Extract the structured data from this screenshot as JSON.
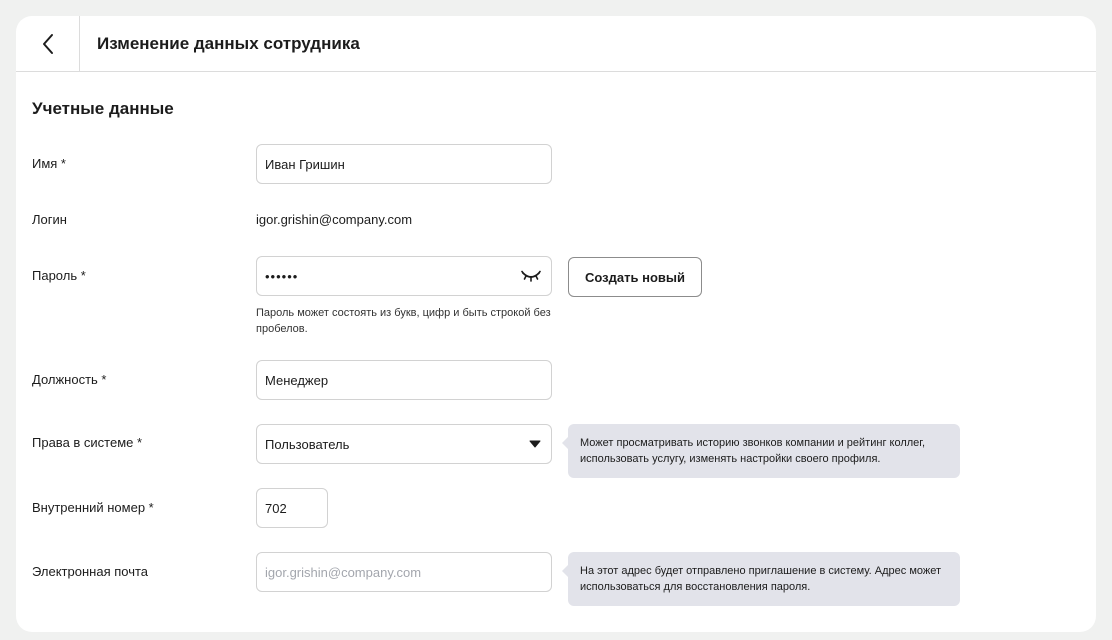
{
  "header": {
    "title": "Изменение данных сотрудника"
  },
  "section": {
    "title": "Учетные данные"
  },
  "form": {
    "name": {
      "label": "Имя *",
      "value": "Иван Гришин"
    },
    "login": {
      "label": "Логин",
      "value": "igor.grishin@company.com"
    },
    "password": {
      "label": "Пароль *",
      "value": "••••••",
      "hint": "Пароль может состоять из букв, цифр и быть строкой без пробелов.",
      "generate_label": "Создать новый"
    },
    "position": {
      "label": "Должность *",
      "value": "Менеджер"
    },
    "rights": {
      "label": "Права в системе *",
      "value": "Пользователь",
      "tooltip": "Может просматривать историю звонков компании и рейтинг коллег, использовать услугу, изменять настройки своего профиля."
    },
    "extension": {
      "label": "Внутренний номер *",
      "value": "702"
    },
    "email": {
      "label": "Электронная почта",
      "placeholder": "igor.grishin@company.com",
      "tooltip": "На этот адрес будет отправлено приглашение в систему. Адрес может использоваться для восстановления пароля."
    }
  },
  "icons": {
    "back": "chevron-left-icon",
    "password_toggle": "eye-closed-icon",
    "dropdown": "caret-down-icon"
  }
}
